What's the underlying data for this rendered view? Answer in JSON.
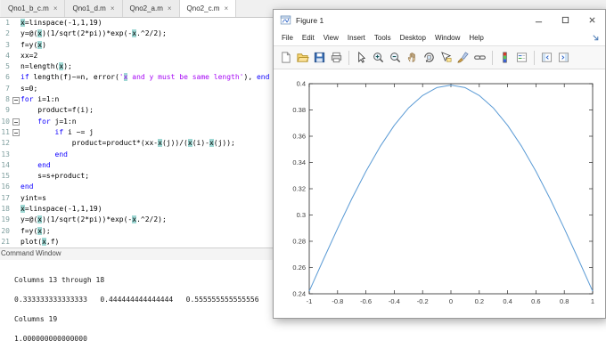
{
  "editor": {
    "active_tab": "Qno2_c.m",
    "close_glyph": "×",
    "tabs": [
      {
        "label": "Qno1_b_c.m"
      },
      {
        "label": "Qno1_d.m"
      },
      {
        "label": "Qno2_a.m"
      },
      {
        "label": "Qno2_c.m"
      }
    ],
    "code_lines": [
      {
        "n": 1,
        "text": "x=linspace(-1,1,19)"
      },
      {
        "n": 2,
        "text": "y=@(x)(1/sqrt(2*pi))*exp(-x.^2/2);"
      },
      {
        "n": 3,
        "text": "f=y(x)"
      },
      {
        "n": 4,
        "text": "xx=2"
      },
      {
        "n": 5,
        "text": "n=length(x);"
      },
      {
        "n": 6,
        "text": "if length(f)~=n, error('x and y must be same length'), end"
      },
      {
        "n": 7,
        "text": "s=0;"
      },
      {
        "n": 8,
        "text": "for i=1:n",
        "fold": true
      },
      {
        "n": 9,
        "text": "    product=f(i);"
      },
      {
        "n": 10,
        "text": "    for j=1:n",
        "fold": true
      },
      {
        "n": 11,
        "text": "        if i ~= j",
        "fold": true
      },
      {
        "n": 12,
        "text": "            product=product*(xx-x(j))/(x(i)-x(j));"
      },
      {
        "n": 13,
        "text": "        end"
      },
      {
        "n": 14,
        "text": "    end"
      },
      {
        "n": 15,
        "text": "    s=s+product;"
      },
      {
        "n": 16,
        "text": "end"
      },
      {
        "n": 17,
        "text": "yint=s"
      },
      {
        "n": 18,
        "text": "x=linspace(-1,1,19)"
      },
      {
        "n": 19,
        "text": "y=@(x)(1/sqrt(2*pi))*exp(-x.^2/2);"
      },
      {
        "n": 20,
        "text": "f=y(x);"
      },
      {
        "n": 21,
        "text": "plot(x,f)"
      }
    ]
  },
  "command_window": {
    "title": "Command Window",
    "lines": [
      "",
      "Columns 13 through 18",
      "",
      "0.333333333333333   0.444444444444444   0.555555555555556",
      "",
      "Columns 19",
      "",
      "1.000000000000000"
    ]
  },
  "figure": {
    "title": "Figure 1",
    "window_controls": [
      "minimize",
      "maximize",
      "close"
    ],
    "menu": [
      "File",
      "Edit",
      "View",
      "Insert",
      "Tools",
      "Desktop",
      "Window",
      "Help"
    ],
    "toolbar_groups": [
      [
        "new-figure",
        "open-file",
        "save-figure",
        "print-figure"
      ],
      [
        "edit-plot",
        "zoom-in",
        "zoom-out",
        "pan",
        "rotate-3d",
        "data-cursor",
        "brush",
        "link-plot"
      ],
      [
        "insert-colorbar",
        "insert-legend"
      ],
      [
        "hide-plot-tools",
        "show-plot-tools"
      ]
    ]
  },
  "chart_data": {
    "type": "line",
    "title": "",
    "xlabel": "",
    "ylabel": "",
    "x": [
      -1,
      -0.9,
      -0.8,
      -0.7,
      -0.6,
      -0.5,
      -0.4,
      -0.3,
      -0.2,
      -0.1,
      0,
      0.1,
      0.2,
      0.3,
      0.4,
      0.5,
      0.6,
      0.7,
      0.8,
      0.9,
      1
    ],
    "y": [
      0.242,
      0.2661,
      0.2897,
      0.3123,
      0.3332,
      0.3521,
      0.3683,
      0.3814,
      0.391,
      0.397,
      0.3989,
      0.397,
      0.391,
      0.3814,
      0.3683,
      0.3521,
      0.3332,
      0.3123,
      0.2897,
      0.2661,
      0.242
    ],
    "xlim": [
      -1,
      1
    ],
    "ylim": [
      0.24,
      0.4
    ],
    "xticks": [
      -1,
      -0.8,
      -0.6,
      -0.4,
      -0.2,
      0,
      0.2,
      0.4,
      0.6,
      0.8,
      1
    ],
    "xtick_labels": [
      "-1",
      "-0.8",
      "-0.6",
      "-0.4",
      "-0.2",
      "0",
      "0.2",
      "0.4",
      "0.6",
      "0.8",
      "1"
    ],
    "yticks": [
      0.24,
      0.26,
      0.28,
      0.3,
      0.32,
      0.34,
      0.36,
      0.38,
      0.4
    ],
    "ytick_labels": [
      "0.24",
      "0.26",
      "0.28",
      "0.3",
      "0.32",
      "0.34",
      "0.36",
      "0.38",
      "0.4"
    ],
    "line_color": "#5b9bd5",
    "grid": false,
    "legend": false
  }
}
